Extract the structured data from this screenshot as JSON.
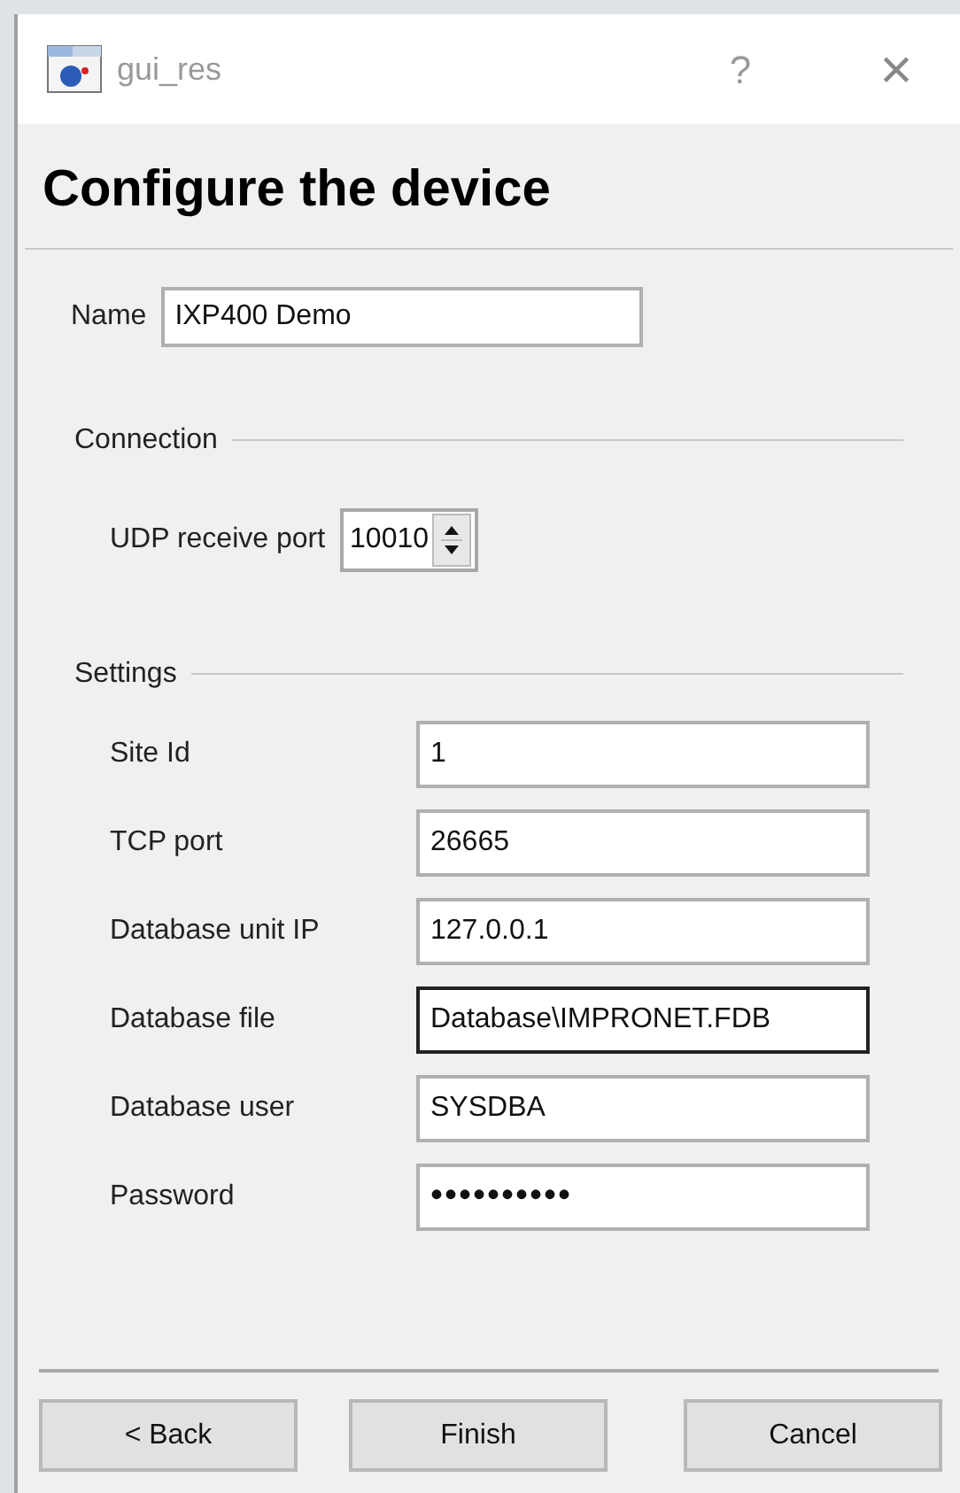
{
  "window": {
    "title": "gui_res",
    "help": "?",
    "close": "×"
  },
  "heading": "Configure the device",
  "name_field": {
    "label": "Name",
    "value": "IXP400 Demo"
  },
  "connection": {
    "title": "Connection",
    "fields": [
      {
        "label": "UDP receive port",
        "value": "10010",
        "kind": "spin"
      }
    ]
  },
  "settings": {
    "title": "Settings",
    "fields": [
      {
        "label": "Site Id",
        "value": "1",
        "kind": "text",
        "focused": false
      },
      {
        "label": "TCP port",
        "value": "26665",
        "kind": "text",
        "focused": false
      },
      {
        "label": "Database unit IP",
        "value": "127.0.0.1",
        "kind": "text",
        "focused": false
      },
      {
        "label": "Database file",
        "value": "Database\\IMPRONET.FDB",
        "kind": "text",
        "focused": true
      },
      {
        "label": "Database user",
        "value": "SYSDBA",
        "kind": "text",
        "focused": false
      },
      {
        "label": "Password",
        "value": "••••••••••",
        "kind": "password",
        "focused": false
      }
    ]
  },
  "buttons": [
    {
      "label": "< Back"
    },
    {
      "label": "Finish"
    },
    {
      "label": "Cancel"
    }
  ]
}
